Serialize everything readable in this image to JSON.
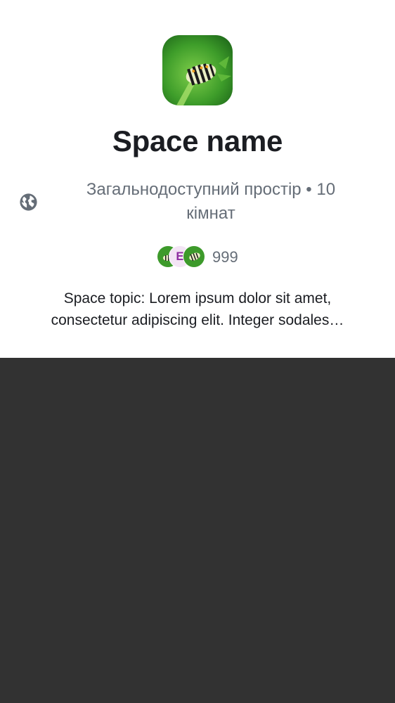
{
  "space": {
    "name": "Space name",
    "avatar_icon": "caterpillar-photo",
    "visibility_icon": "globe-icon",
    "subtitle": "Загальнодоступний простір • 10 кімнат",
    "members": {
      "avatars": [
        "caterpillar-photo",
        "E",
        "caterpillar-photo"
      ],
      "count": "999"
    },
    "topic": "Space topic: Lorem ipsum dolor sit amet, consectetur adipiscing elit. Integer sodales…"
  },
  "colors": {
    "card_background": "#ffffff",
    "page_background": "#323232",
    "title": "#1b1d22",
    "secondary_text": "#656d77",
    "letter_avatar_bg": "#f3e4f5",
    "letter_avatar_fg": "#8e2ea1"
  }
}
